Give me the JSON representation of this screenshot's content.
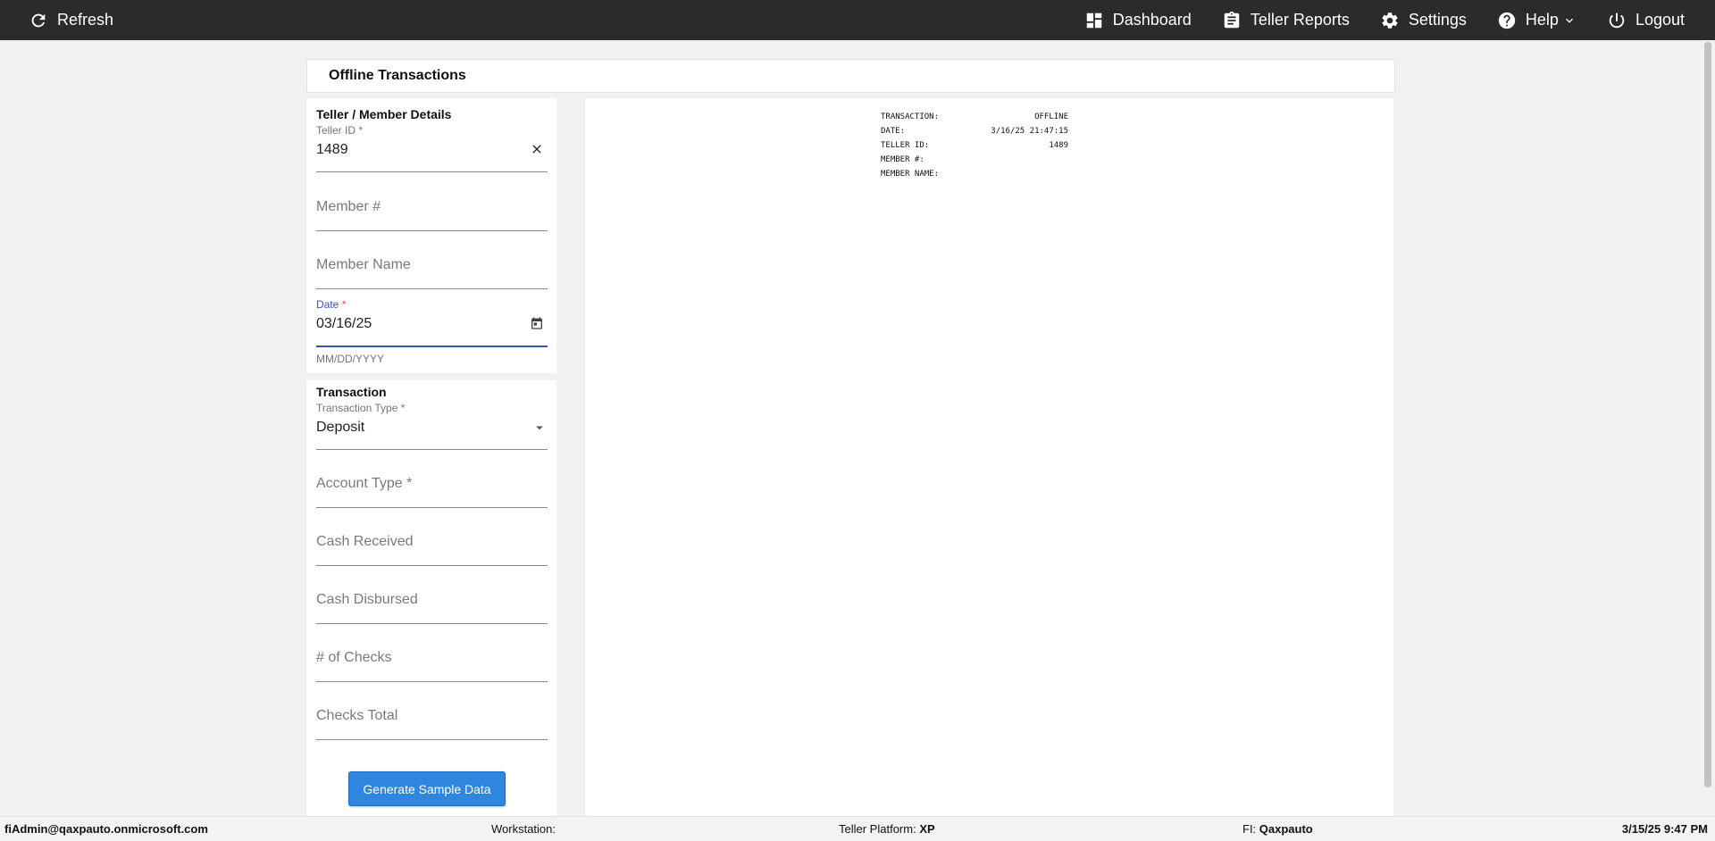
{
  "topbar": {
    "refresh_label": "Refresh",
    "nav": [
      {
        "label": "Dashboard",
        "icon": "dashboard-icon"
      },
      {
        "label": "Teller Reports",
        "icon": "clipboard-icon"
      },
      {
        "label": "Settings",
        "icon": "gear-icon"
      },
      {
        "label": "Help",
        "icon": "help-icon"
      },
      {
        "label": "Logout",
        "icon": "power-icon"
      }
    ]
  },
  "page_title": "Offline Transactions",
  "member_section": {
    "title": "Teller / Member Details",
    "teller_id": {
      "label": "Teller ID *",
      "value": "1489"
    },
    "member_number": {
      "placeholder": "Member #"
    },
    "member_name": {
      "placeholder": "Member Name"
    },
    "date": {
      "label": "Date",
      "required_mark": "*",
      "value": "03/16/25",
      "hint": "MM/DD/YYYY"
    }
  },
  "transaction_section": {
    "title": "Transaction",
    "transaction_type": {
      "label": "Transaction Type *",
      "value": "Deposit"
    },
    "account_type": {
      "placeholder": "Account Type *"
    },
    "cash_received": {
      "placeholder": "Cash Received"
    },
    "cash_disbursed": {
      "placeholder": "Cash Disbursed"
    },
    "num_checks": {
      "placeholder": "# of Checks"
    },
    "checks_total": {
      "placeholder": "Checks Total"
    }
  },
  "generate_button": "Generate Sample Data",
  "receipt": {
    "rows": [
      {
        "key": "TRANSACTION:",
        "value": "OFFLINE"
      },
      {
        "key": "DATE:",
        "value": "3/16/25 21:47:15"
      },
      {
        "key": "TELLER ID:",
        "value": "1489"
      },
      {
        "key": "MEMBER #:",
        "value": ""
      },
      {
        "key": "MEMBER NAME:",
        "value": ""
      }
    ]
  },
  "statusbar": {
    "user": "fiAdmin@qaxpauto.onmicrosoft.com",
    "workstation_label": "Workstation:",
    "workstation_value": "",
    "platform_label": "Teller Platform:",
    "platform_value": "XP",
    "fi_label": "FI:",
    "fi_value": "Qaxpauto",
    "datetime": "3/15/25 9:47 PM"
  },
  "colors": {
    "topbar": "#2b2b2b",
    "accent": "#3f51b5",
    "button": "#2e86de"
  }
}
